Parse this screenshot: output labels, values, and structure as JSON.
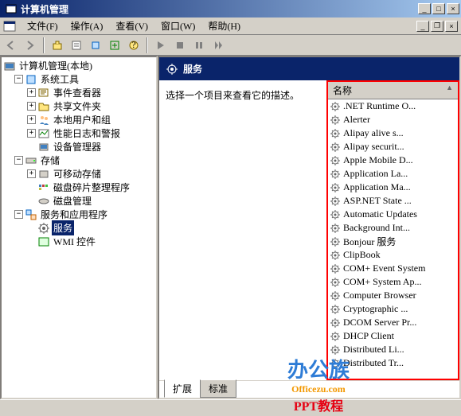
{
  "window": {
    "title": "计算机管理",
    "min": "_",
    "max": "□",
    "close": "×"
  },
  "menu": {
    "file": "文件(F)",
    "action": "操作(A)",
    "view": "查看(V)",
    "window": "窗口(W)",
    "help": "帮助(H)",
    "doc_min": "_",
    "doc_restore": "❐",
    "doc_close": "×"
  },
  "tree": {
    "root": "计算机管理(本地)",
    "sys_tools": "系统工具",
    "event_viewer": "事件查看器",
    "shared": "共享文件夹",
    "users": "本地用户和组",
    "perf": "性能日志和警报",
    "devmgr": "设备管理器",
    "storage": "存储",
    "removable": "可移动存储",
    "defrag": "磁盘碎片整理程序",
    "diskmgr": "磁盘管理",
    "apps": "服务和应用程序",
    "services": "服务",
    "wmi": "WMI 控件"
  },
  "panel": {
    "title": "服务",
    "desc": "选择一个项目来查看它的描述。",
    "col_name": "名称"
  },
  "services": [
    ".NET Runtime O...",
    "Alerter",
    "Alipay alive s...",
    "Alipay securit...",
    "Apple Mobile D...",
    "Application La...",
    "Application Ma...",
    "ASP.NET State ...",
    "Automatic Updates",
    "Background Int...",
    "Bonjour 服务",
    "ClipBook",
    "COM+ Event System",
    "COM+ System Ap...",
    "Computer Browser",
    "Cryptographic ...",
    "DCOM Server Pr...",
    "DHCP Client",
    "Distributed Li...",
    "Distributed Tr..."
  ],
  "tabs": {
    "ext": "扩展",
    "std": "标准"
  },
  "watermark": {
    "l1": "办公族",
    "l2": "Officezu.com",
    "l3": "PPT教程"
  }
}
